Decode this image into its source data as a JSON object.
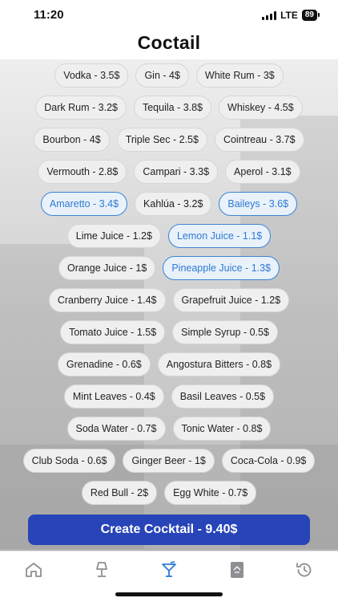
{
  "status": {
    "time": "11:20",
    "network": "LTE",
    "battery": "89"
  },
  "title": "Coctail",
  "ingredient_rows": [
    [
      {
        "label": "Vodka - 3.5$",
        "selected": false
      },
      {
        "label": "Gin - 4$",
        "selected": false
      },
      {
        "label": "White Rum - 3$",
        "selected": false
      }
    ],
    [
      {
        "label": "Dark Rum - 3.2$",
        "selected": false
      },
      {
        "label": "Tequila - 3.8$",
        "selected": false
      },
      {
        "label": "Whiskey - 4.5$",
        "selected": false
      }
    ],
    [
      {
        "label": "Bourbon - 4$",
        "selected": false
      },
      {
        "label": "Triple Sec - 2.5$",
        "selected": false
      },
      {
        "label": "Cointreau - 3.7$",
        "selected": false
      }
    ],
    [
      {
        "label": "Vermouth - 2.8$",
        "selected": false
      },
      {
        "label": "Campari - 3.3$",
        "selected": false
      },
      {
        "label": "Aperol - 3.1$",
        "selected": false
      }
    ],
    [
      {
        "label": "Amaretto - 3.4$",
        "selected": true
      },
      {
        "label": "Kahlúa - 3.2$",
        "selected": false
      },
      {
        "label": "Baileys - 3.6$",
        "selected": true
      }
    ],
    [
      {
        "label": "Lime Juice - 1.2$",
        "selected": false
      },
      {
        "label": "Lemon Juice - 1.1$",
        "selected": true
      }
    ],
    [
      {
        "label": "Orange Juice - 1$",
        "selected": false
      },
      {
        "label": "Pineapple Juice - 1.3$",
        "selected": true
      }
    ],
    [
      {
        "label": "Cranberry Juice - 1.4$",
        "selected": false
      },
      {
        "label": "Grapefruit Juice - 1.2$",
        "selected": false
      }
    ],
    [
      {
        "label": "Tomato Juice - 1.5$",
        "selected": false
      },
      {
        "label": "Simple Syrup - 0.5$",
        "selected": false
      }
    ],
    [
      {
        "label": "Grenadine - 0.6$",
        "selected": false
      },
      {
        "label": "Angostura Bitters - 0.8$",
        "selected": false
      }
    ],
    [
      {
        "label": "Mint Leaves - 0.4$",
        "selected": false
      },
      {
        "label": "Basil Leaves - 0.5$",
        "selected": false
      }
    ],
    [
      {
        "label": "Soda Water - 0.7$",
        "selected": false
      },
      {
        "label": "Tonic Water - 0.8$",
        "selected": false
      }
    ],
    [
      {
        "label": "Club Soda - 0.6$",
        "selected": false
      },
      {
        "label": "Ginger Beer - 1$",
        "selected": false
      },
      {
        "label": "Coca-Cola - 0.9$",
        "selected": false
      }
    ],
    [
      {
        "label": "Red Bull - 2$",
        "selected": false
      },
      {
        "label": "Egg White - 0.7$",
        "selected": false
      }
    ]
  ],
  "create_button": {
    "label": "Create Cocktail - 9.40$"
  },
  "tabs": [
    {
      "name": "tab-home",
      "icon": "home-icon",
      "active": false
    },
    {
      "name": "tab-bar-lamp",
      "icon": "lamp-icon",
      "active": false
    },
    {
      "name": "tab-cocktail",
      "icon": "cocktail-glass-icon",
      "active": true
    },
    {
      "name": "tab-menu",
      "icon": "menu-book-icon",
      "active": false
    },
    {
      "name": "tab-history",
      "icon": "history-icon",
      "active": false
    }
  ],
  "colors": {
    "accent": "#2d7bd2",
    "button": "#2744b8",
    "inactive_icon": "#8e8e93"
  }
}
